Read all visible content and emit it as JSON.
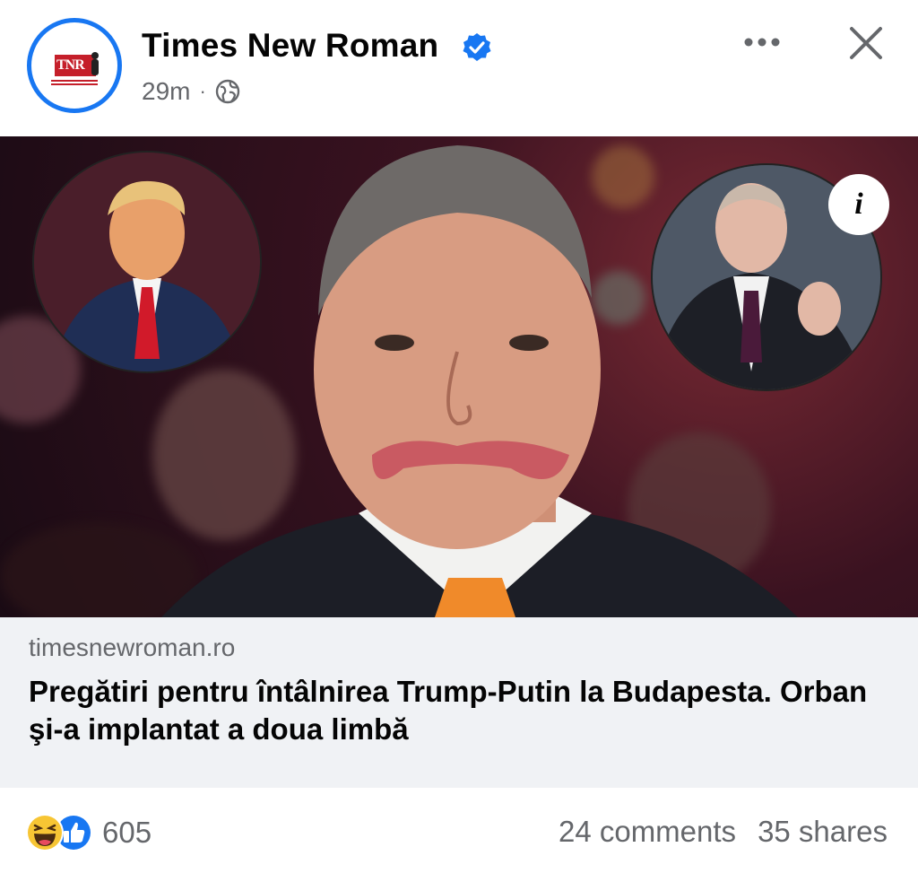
{
  "post": {
    "page_name": "Times New Roman",
    "time": "29m",
    "separator": "·",
    "avatar_logo_text": "TNR",
    "icons": {
      "verified": "verified-badge-icon",
      "audience": "globe-icon",
      "more": "more-options-icon",
      "close": "close-icon",
      "info": "info-icon"
    },
    "accent_color": "#1877f2"
  },
  "link_preview": {
    "domain": "timesnewroman.ro",
    "headline": "Pregătiri pentru întâlnirea Trump-Putin la Budapesta. Orban şi-a implantat a doua limbă",
    "info_label": "i"
  },
  "footer": {
    "reaction_icons": [
      "haha-reaction-icon",
      "like-reaction-icon"
    ],
    "reaction_count": "605",
    "comments": "24 comments",
    "shares": "35 shares"
  }
}
